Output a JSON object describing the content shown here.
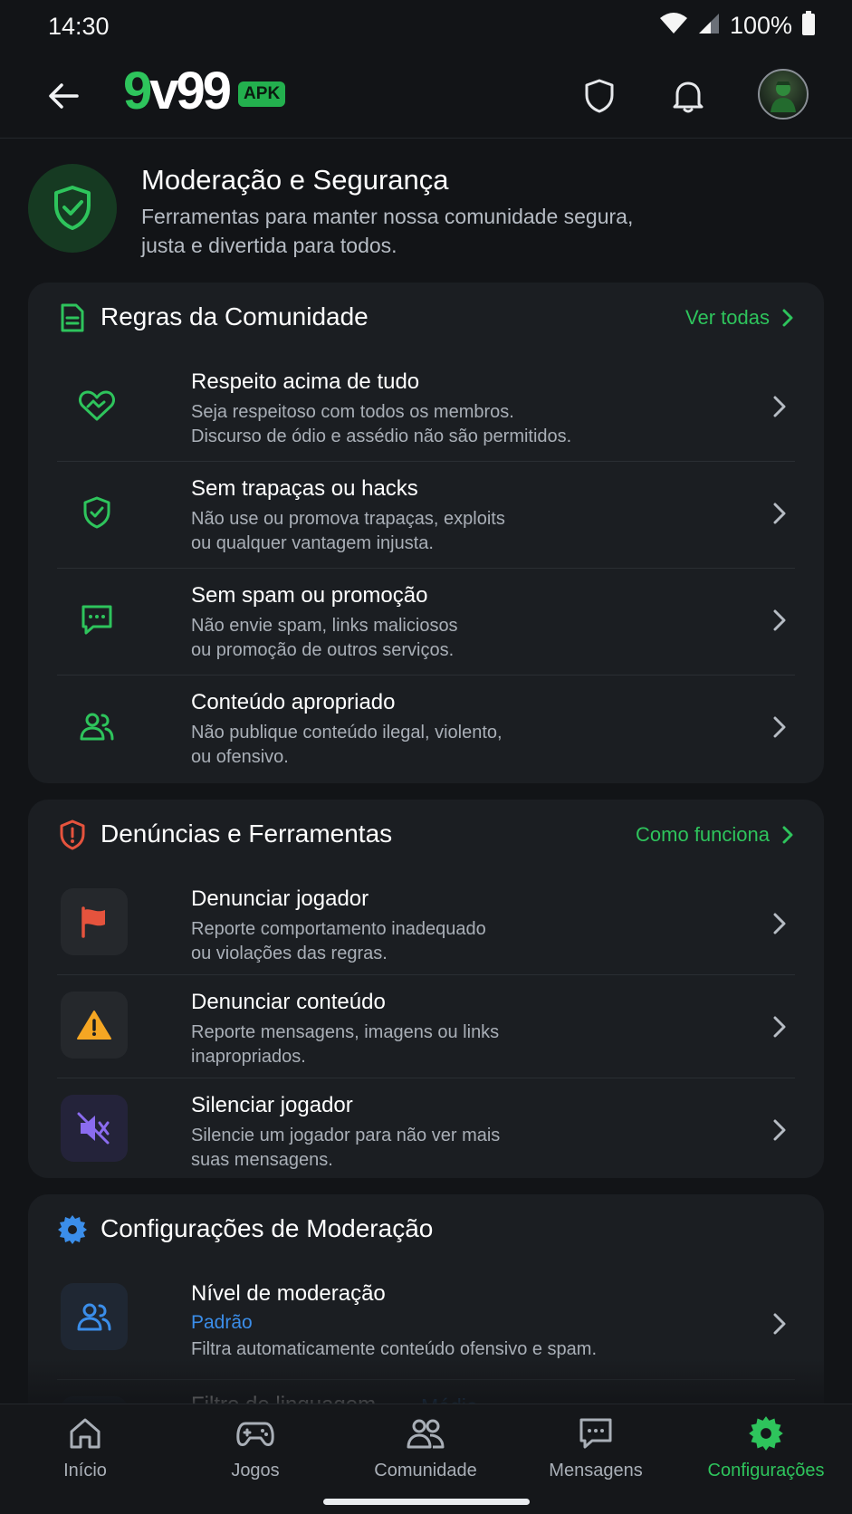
{
  "status_bar": {
    "time": "14:30",
    "battery": "100%"
  },
  "header": {
    "logo": {
      "part1": "9",
      "part2": "v99",
      "badge": "APK"
    },
    "icons": [
      "back-arrow-icon",
      "shield-icon",
      "bell-icon",
      "avatar"
    ]
  },
  "hero": {
    "title": "Moderação e Segurança",
    "subtitle": "Ferramentas para manter nossa comunidade segura, justa e divertida para todos."
  },
  "rules": {
    "title": "Regras da Comunidade",
    "link": "Ver todas",
    "items": [
      {
        "title": "Respeito acima de tudo",
        "desc_1": "Seja respeitoso com todos os membros.",
        "desc_2": "Discurso de ódio e assédio não são permitidos.",
        "icon": "handshake-heart-icon"
      },
      {
        "title": "Sem trapaças ou hacks",
        "desc_1": "Não use ou promova trapaças, exploits",
        "desc_2": "ou qualquer vantagem injusta.",
        "icon": "shield-check-icon"
      },
      {
        "title": "Sem spam ou promoção",
        "desc_1": "Não envie spam, links maliciosos",
        "desc_2": "ou promoção de outros serviços.",
        "icon": "chat-bubble-icon"
      },
      {
        "title": "Conteúdo apropriado",
        "desc_1": "Não publique conteúdo ilegal, violento,",
        "desc_2": "ou ofensivo.",
        "icon": "users-icon"
      }
    ]
  },
  "reports": {
    "title": "Denúncias e Ferramentas",
    "link": "Como funciona",
    "items": [
      {
        "title": "Denunciar jogador",
        "desc_1": "Reporte comportamento inadequado",
        "desc_2": "ou violações das regras.",
        "icon": "flag-icon"
      },
      {
        "title": "Denunciar conteúdo",
        "desc_1": "Reporte mensagens, imagens ou links",
        "desc_2": "inapropriados.",
        "icon": "warning-icon"
      },
      {
        "title": "Silenciar jogador",
        "desc_1": "Silencie um jogador para não ver mais",
        "desc_2": "suas mensagens.",
        "icon": "mute-icon"
      }
    ]
  },
  "settings": {
    "title": "Configurações de Moderação",
    "items": [
      {
        "title": "Nível de moderação",
        "value": "Padrão",
        "desc": "Filtra automaticamente conteúdo ofensivo e spam.",
        "icon": "users-icon"
      },
      {
        "title": "Filtro de linguagem",
        "value": "Médio",
        "icon": "users-icon"
      }
    ]
  },
  "bottom_nav": {
    "items": [
      {
        "label": "Início",
        "icon": "home-icon"
      },
      {
        "label": "Jogos",
        "icon": "gamepad-icon"
      },
      {
        "label": "Comunidade",
        "icon": "community-icon"
      },
      {
        "label": "Mensagens",
        "icon": "messages-icon"
      },
      {
        "label": "Configurações",
        "icon": "gear-icon",
        "active": true
      }
    ]
  },
  "colors": {
    "accent": "#2ec45c",
    "link_blue": "#3b8eea",
    "danger": "#e5533d",
    "warning": "#f5a623",
    "purple": "#8b6cf0",
    "card_bg": "#1b1e22",
    "page_bg": "#121417"
  }
}
